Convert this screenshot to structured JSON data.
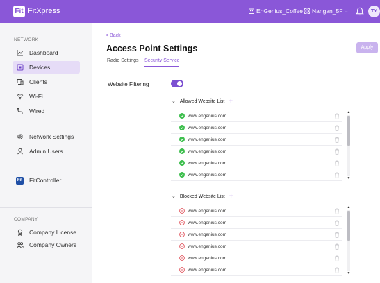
{
  "topbar": {
    "logo_text": "Fit",
    "app_title": "FitXpress",
    "org_name": "EnGenius_Coffee",
    "site_name": "Nangan_5F",
    "avatar_initials": "TY",
    "accent": "#8a57d8"
  },
  "sidebar": {
    "network_label": "NETWORK",
    "items": [
      {
        "label": "Dashboard",
        "icon": "chart-icon"
      },
      {
        "label": "Devices",
        "icon": "device-icon"
      },
      {
        "label": "Clients",
        "icon": "clients-icon"
      },
      {
        "label": "Wi-Fi",
        "icon": "wifi-icon"
      },
      {
        "label": "Wired",
        "icon": "wired-icon"
      },
      {
        "label": "Network Settings",
        "icon": "gear-icon"
      },
      {
        "label": "Admin Users",
        "icon": "user-icon"
      },
      {
        "label": "FitController",
        "icon": "fitcontroller-icon"
      }
    ],
    "fc_icon_text": "Fit",
    "company_label": "COMPANY",
    "company_items": [
      {
        "label": "Company License",
        "icon": "license-icon"
      },
      {
        "label": "Company Owners",
        "icon": "owners-icon"
      }
    ]
  },
  "main": {
    "back_label": "< Back",
    "title": "Access Point Settings",
    "apply_label": "Apply",
    "tabs": [
      {
        "label": "Radio Settings"
      },
      {
        "label": "Security Service"
      }
    ],
    "website_filtering_label": "Website Filtering",
    "website_filtering_enabled": true,
    "allowed": {
      "title": "Allowed  Website List",
      "status_color": "#3fbf4f",
      "items": [
        "www.engenius.com",
        "www.engenius.com",
        "www.engenius.com",
        "www.engenius.com",
        "www.engenius.com",
        "www.engenius.com"
      ]
    },
    "blocked": {
      "title": "Blocked  Website List",
      "status_color": "#e0525b",
      "items": [
        "www.engenius.com",
        "www.engenius.com",
        "www.engenius.com",
        "www.engenius.com",
        "www.engenius.com",
        "www.engenius.com"
      ]
    }
  }
}
